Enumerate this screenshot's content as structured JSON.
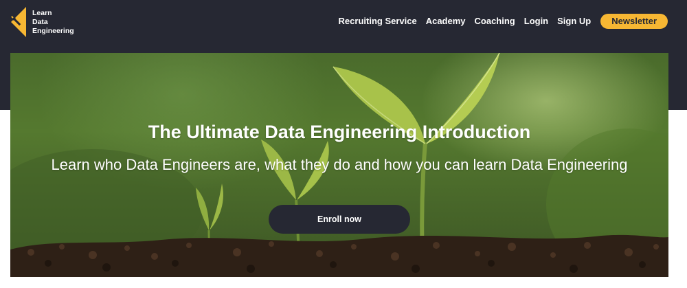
{
  "header": {
    "logo": {
      "line1": "Learn",
      "line2": "Data",
      "line3": "Engineering"
    },
    "nav": [
      {
        "label": "Recruiting Service"
      },
      {
        "label": "Academy"
      },
      {
        "label": "Coaching"
      },
      {
        "label": "Login"
      },
      {
        "label": "Sign Up"
      }
    ],
    "newsletter_label": "Newsletter"
  },
  "hero": {
    "title": "The Ultimate Data Engineering Introduction",
    "subtitle": "Learn who Data Engineers are, what they do and how you can learn Data Engineering",
    "cta_label": "Enroll now",
    "image": "seedlings-growing-in-soil"
  },
  "colors": {
    "dark": "#262833",
    "accent": "#f7b733",
    "white": "#ffffff"
  }
}
